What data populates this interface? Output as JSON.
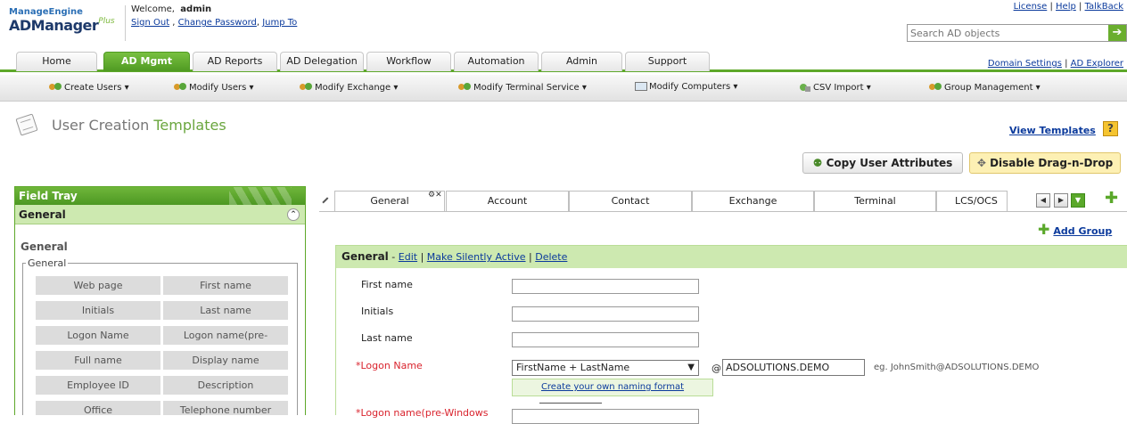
{
  "header": {
    "logo_top": "ManageEngine",
    "logo_main": "ADManager",
    "logo_plus": "Plus",
    "welcome_prefix": "Welcome,",
    "welcome_user": "admin",
    "user_links": [
      "Sign Out",
      "Change Password",
      "Jump To"
    ],
    "top_links": [
      "License",
      "Help",
      "TalkBack"
    ],
    "search_placeholder": "Search AD objects"
  },
  "tabs": {
    "items": [
      "Home",
      "AD Mgmt",
      "AD Reports",
      "AD Delegation",
      "Workflow",
      "Automation",
      "Admin",
      "Support"
    ],
    "active": "AD Mgmt",
    "right_links": [
      "Domain Settings",
      "AD Explorer"
    ]
  },
  "subnav": {
    "items": [
      "Create Users ▾",
      "Modify Users ▾",
      "Modify Exchange ▾",
      "Modify Terminal Service ▾",
      "Modify Computers ▾",
      "CSV Import ▾",
      "Group Management ▾"
    ]
  },
  "page": {
    "title_part1": "User Creation",
    "title_part2": "Templates",
    "view_templates": "View Templates",
    "help": "?",
    "copy_attributes": "Copy User Attributes",
    "disable_drag": "Disable Drag-n-Drop"
  },
  "tray": {
    "title": "Field Tray",
    "section": "General",
    "group_title": "General",
    "legend": "General",
    "fields": [
      "Web page",
      "First name",
      "Initials",
      "Last name",
      "Logon Name",
      "Logon name(pre-",
      "Full name",
      "Display name",
      "Employee ID",
      "Description",
      "Office",
      "Telephone number"
    ]
  },
  "form_tabs": {
    "items": [
      "General",
      "Account",
      "Contact",
      "Exchange",
      "Terminal",
      "LCS/OCS"
    ],
    "active": "General",
    "add_group": "Add Group"
  },
  "form": {
    "header_title": "General",
    "header_links": [
      "Edit",
      "Make Silently Active",
      "Delete"
    ],
    "labels": [
      "First name",
      "Initials",
      "Last name"
    ],
    "logon_label": "*Logon Name",
    "logon_format": "FirstName + LastName",
    "at": "@",
    "domain": "ADSOLUTIONS.DEMO",
    "example": "eg.  JohnSmith@ADSOLUTIONS.DEMO",
    "naming_link": "Create your own naming format",
    "truncated_label": "*Logon name(pre-Windows"
  }
}
